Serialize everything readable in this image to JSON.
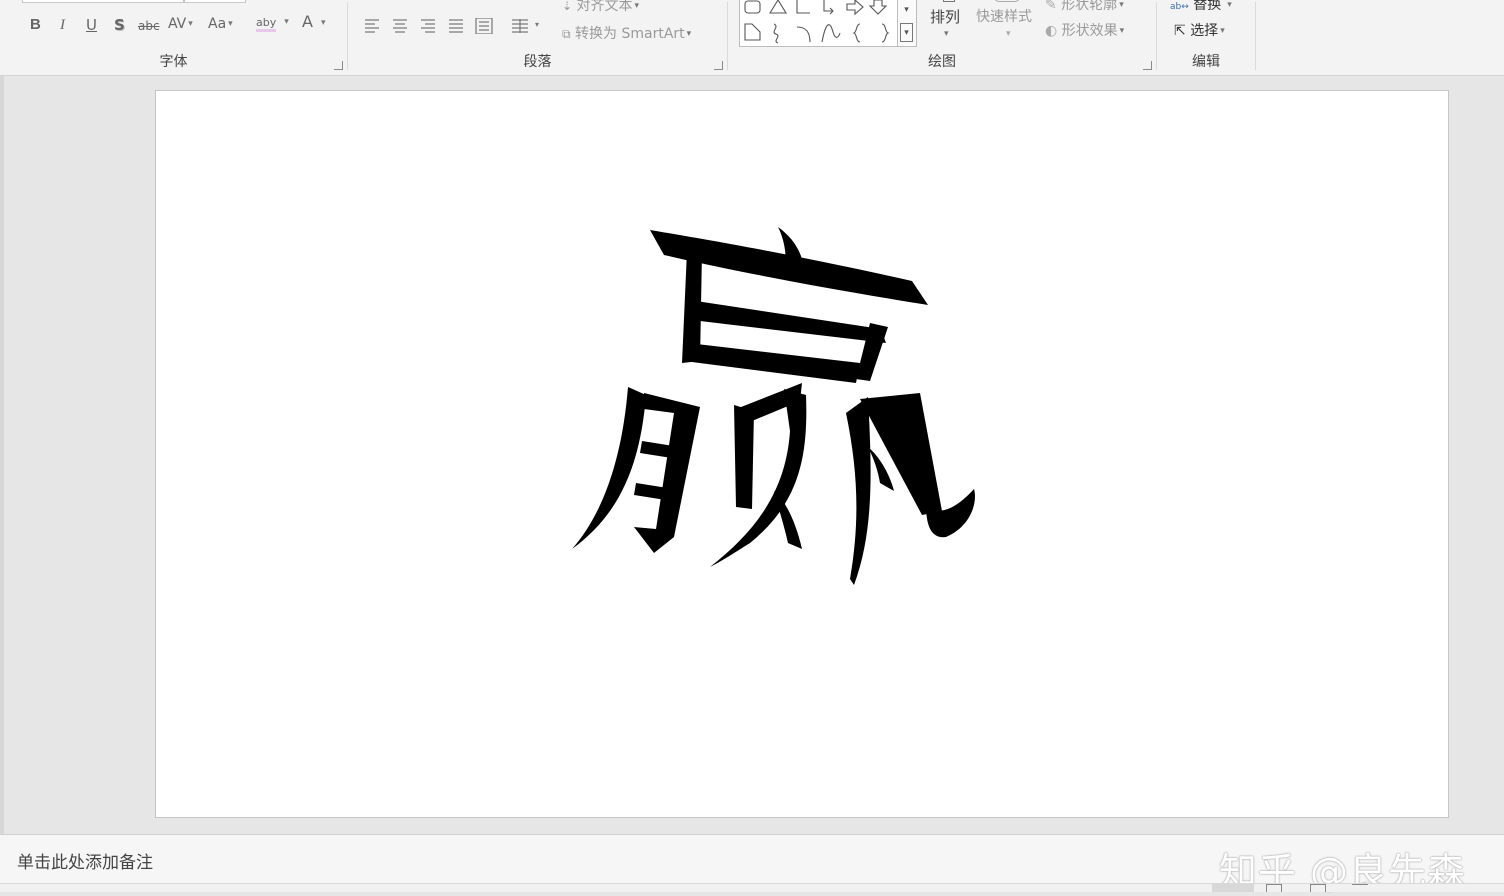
{
  "ribbon": {
    "font_group": {
      "label": "字体",
      "buttons": {
        "bold": "B",
        "italic": "I",
        "underline": "U",
        "shadow": "S",
        "strikethrough": "abc",
        "char_spacing": "AV",
        "change_case": "Aa",
        "highlight": "aby",
        "font_color": "A"
      }
    },
    "paragraph_group": {
      "label": "段落",
      "align_text": "对齐文本",
      "convert_smartart": "转换为 SmartArt"
    },
    "drawing_group": {
      "label": "绘图",
      "arrange": "排列",
      "quick_styles": "快速样式",
      "shape_outline": "形状轮廓",
      "shape_effects": "形状效果"
    },
    "editing_group": {
      "label": "编辑",
      "replace": "替换",
      "select": "选择"
    }
  },
  "slide": {
    "glyph_description_color": "#000000"
  },
  "notes": {
    "placeholder": "单击此处添加备注"
  },
  "watermark": {
    "text": "知乎 @良先森"
  },
  "colors": {
    "ribbon_bg": "#f3f3f3",
    "workspace_bg": "#e6e6e6",
    "slide_bg": "#ffffff"
  }
}
